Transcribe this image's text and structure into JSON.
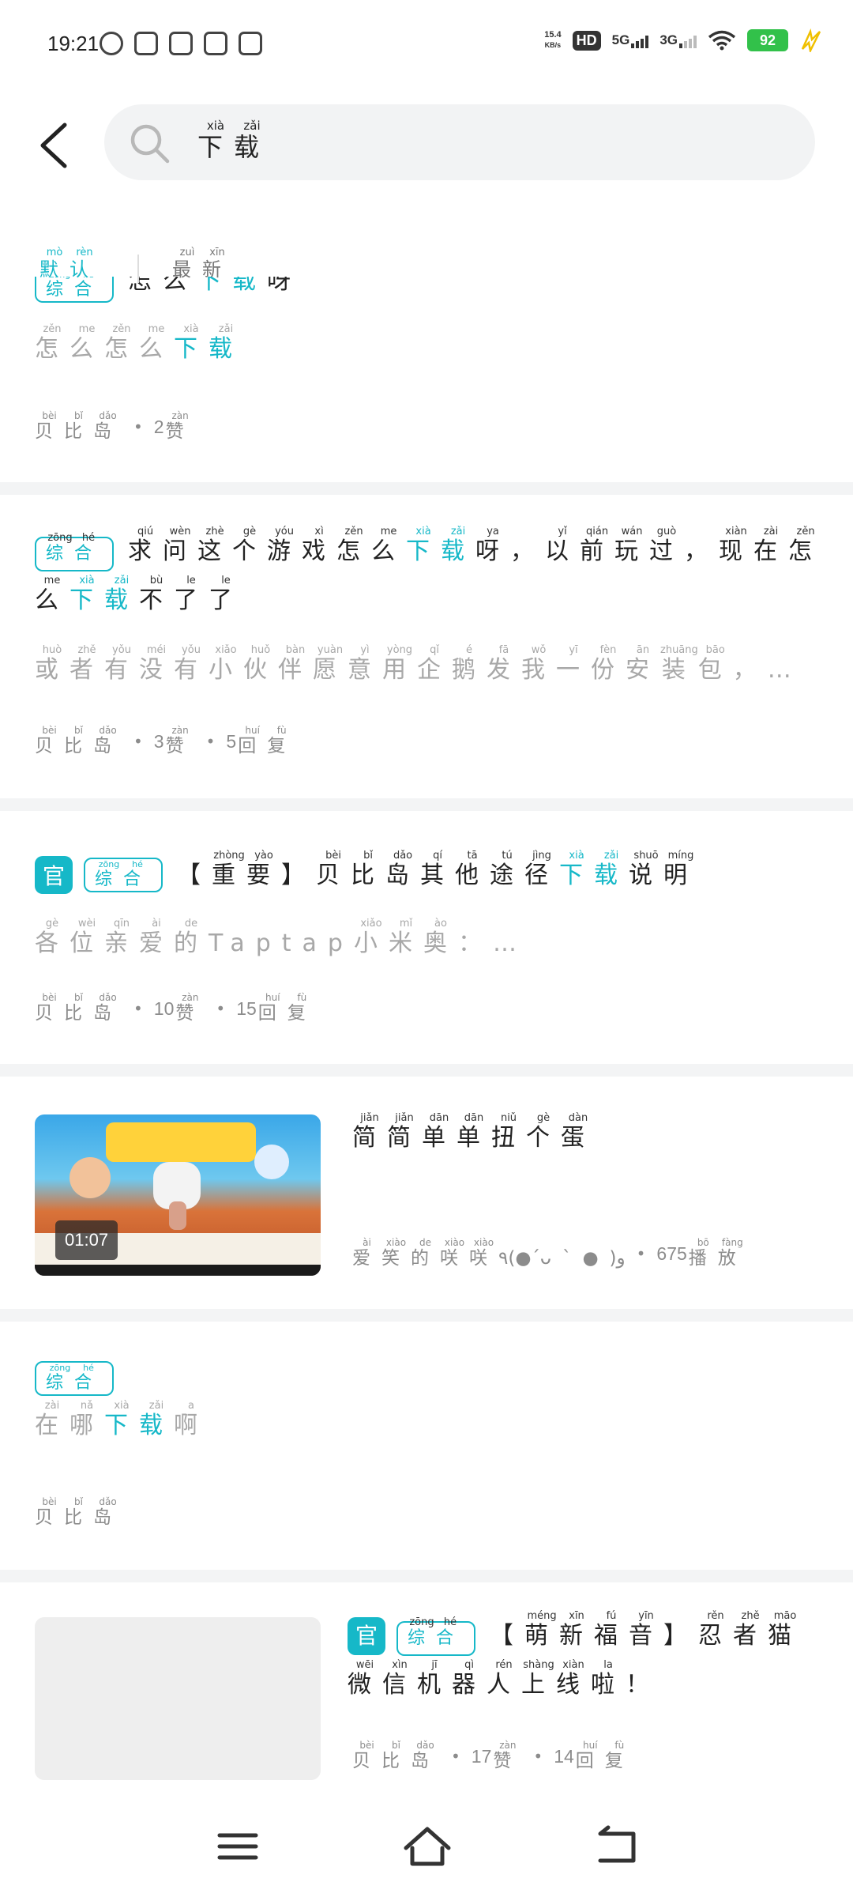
{
  "status_bar": {
    "time": "19:21",
    "net_speed": "15.4",
    "net_unit": "KB/s",
    "hd": "HD",
    "sim1": "5G",
    "sim2": "3G",
    "battery": "92",
    "app_icons": [
      "hamster-icon",
      "shopping-bag-icon",
      "team-icon",
      "qq-music-icon",
      "alipay-icon"
    ]
  },
  "header": {
    "search_value": [
      {
        "c": "下",
        "p": "xià"
      },
      {
        "c": "载",
        "p": "zǎi"
      }
    ]
  },
  "filters": [
    {
      "label": [
        {
          "c": "默",
          "p": "mò"
        },
        {
          "c": "认",
          "p": "rèn"
        }
      ],
      "active": true
    },
    {
      "label": [
        {
          "c": "最",
          "p": "zuì"
        },
        {
          "c": "新",
          "p": "xīn"
        }
      ],
      "active": false
    }
  ],
  "tags": {
    "official": "官",
    "general": [
      {
        "c": "综",
        "p": "zōng"
      },
      {
        "c": "合",
        "p": "hé"
      }
    ]
  },
  "posts": [
    {
      "title_partial": [
        {
          "c": "怎"
        },
        {
          "c": "么"
        },
        {
          "c": "下",
          "h": true
        },
        {
          "c": "载",
          "h": true
        },
        {
          "c": "呀"
        }
      ],
      "snippet": [
        {
          "c": "怎",
          "p": "zěn"
        },
        {
          "c": "么",
          "p": "me"
        },
        {
          "c": "怎",
          "p": "zěn"
        },
        {
          "c": "么",
          "p": "me"
        },
        {
          "c": "下",
          "p": "xià",
          "h": true
        },
        {
          "c": "载",
          "p": "zǎi",
          "h": true
        }
      ],
      "meta": {
        "author": [
          {
            "c": "贝",
            "p": "bèi"
          },
          {
            "c": "比",
            "p": "bǐ"
          },
          {
            "c": "岛",
            "p": "dǎo"
          }
        ],
        "likes": "2"
      }
    },
    {
      "title": [
        {
          "c": "求",
          "p": "qiú"
        },
        {
          "c": "问",
          "p": "wèn"
        },
        {
          "c": "这",
          "p": "zhè"
        },
        {
          "c": "个",
          "p": "gè"
        },
        {
          "c": "游",
          "p": "yóu"
        },
        {
          "c": "戏",
          "p": "xì"
        },
        {
          "c": "怎",
          "p": "zěn"
        },
        {
          "c": "么",
          "p": "me"
        },
        {
          "c": "下",
          "p": "xià",
          "h": true
        },
        {
          "c": "载",
          "p": "zǎi",
          "h": true
        },
        {
          "c": "呀",
          "p": "ya"
        },
        {
          "c": "，"
        },
        {
          "c": "以",
          "p": "yǐ"
        },
        {
          "c": "前",
          "p": "qián"
        },
        {
          "c": "玩",
          "p": "wán"
        },
        {
          "c": "过",
          "p": "guò"
        },
        {
          "c": "，"
        },
        {
          "c": "现",
          "p": "xiàn"
        },
        {
          "c": "在",
          "p": "zài"
        },
        {
          "c": "怎",
          "p": "zěn"
        },
        {
          "c": "么",
          "p": "me"
        },
        {
          "c": "下",
          "p": "xià",
          "h": true
        },
        {
          "c": "载",
          "p": "zǎi",
          "h": true
        },
        {
          "c": "不",
          "p": "bù"
        },
        {
          "c": "了",
          "p": "le"
        },
        {
          "c": "了",
          "p": "le"
        }
      ],
      "snippet": [
        {
          "c": "或",
          "p": "huò"
        },
        {
          "c": "者",
          "p": "zhě"
        },
        {
          "c": "有",
          "p": "yǒu"
        },
        {
          "c": "没",
          "p": "méi"
        },
        {
          "c": "有",
          "p": "yǒu"
        },
        {
          "c": "小",
          "p": "xiǎo"
        },
        {
          "c": "伙",
          "p": "huǒ"
        },
        {
          "c": "伴",
          "p": "bàn"
        },
        {
          "c": "愿",
          "p": "yuàn"
        },
        {
          "c": "意",
          "p": "yì"
        },
        {
          "c": "用",
          "p": "yòng"
        },
        {
          "c": "企",
          "p": "qǐ"
        },
        {
          "c": "鹅",
          "p": "é"
        },
        {
          "c": "发",
          "p": "fā"
        },
        {
          "c": "我",
          "p": "wǒ"
        },
        {
          "c": "一",
          "p": "yī"
        },
        {
          "c": "份",
          "p": "fèn"
        },
        {
          "c": "安",
          "p": "ān"
        },
        {
          "c": "装",
          "p": "zhuāng"
        },
        {
          "c": "包",
          "p": "bāo"
        },
        {
          "c": "，…"
        }
      ],
      "meta": {
        "author": [
          {
            "c": "贝",
            "p": "bèi"
          },
          {
            "c": "比",
            "p": "bǐ"
          },
          {
            "c": "岛",
            "p": "dǎo"
          }
        ],
        "likes": "3",
        "replies": "5"
      }
    },
    {
      "title": [
        {
          "c": "【"
        },
        {
          "c": "重",
          "p": "zhòng"
        },
        {
          "c": "要",
          "p": "yào"
        },
        {
          "c": "】"
        },
        {
          "c": "贝",
          "p": "bèi"
        },
        {
          "c": "比",
          "p": "bǐ"
        },
        {
          "c": "岛",
          "p": "dǎo"
        },
        {
          "c": "其",
          "p": "qí"
        },
        {
          "c": "他",
          "p": "tā"
        },
        {
          "c": "途",
          "p": "tú"
        },
        {
          "c": "径",
          "p": "jìng"
        },
        {
          "c": "下",
          "p": "xià",
          "h": true
        },
        {
          "c": "载",
          "p": "zǎi",
          "h": true
        },
        {
          "c": "说",
          "p": "shuō"
        },
        {
          "c": "明",
          "p": "míng"
        }
      ],
      "snippet": [
        {
          "c": "各",
          "p": "gè"
        },
        {
          "c": "位",
          "p": "wèi"
        },
        {
          "c": "亲",
          "p": "qīn"
        },
        {
          "c": "爱",
          "p": "ài"
        },
        {
          "c": "的",
          "p": "de"
        },
        {
          "c": "Taptap"
        },
        {
          "c": "小",
          "p": "xiǎo"
        },
        {
          "c": "米",
          "p": "mǐ"
        },
        {
          "c": "奥",
          "p": "ào"
        },
        {
          "c": "：…"
        }
      ],
      "meta": {
        "author": [
          {
            "c": "贝",
            "p": "bèi"
          },
          {
            "c": "比",
            "p": "bǐ"
          },
          {
            "c": "岛",
            "p": "dǎo"
          }
        ],
        "likes": "10",
        "replies": "15"
      }
    },
    {
      "title": [
        {
          "c": "简",
          "p": "jiǎn"
        },
        {
          "c": "简",
          "p": "jiǎn"
        },
        {
          "c": "单",
          "p": "dān"
        },
        {
          "c": "单",
          "p": "dān"
        },
        {
          "c": "扭",
          "p": "niǔ"
        },
        {
          "c": "个",
          "p": "gè"
        },
        {
          "c": "蛋",
          "p": "dàn"
        }
      ],
      "duration": "01:07",
      "meta": {
        "author": [
          {
            "c": "爱",
            "p": "ài"
          },
          {
            "c": "笑",
            "p": "xiào"
          },
          {
            "c": "的",
            "p": "de"
          },
          {
            "c": "咲",
            "p": "xiào"
          },
          {
            "c": "咲",
            "p": "xiào"
          },
          {
            "c": "٩(●ˊᴗˋ●)و"
          }
        ],
        "plays": "675"
      }
    },
    {
      "title": [
        {
          "c": "在",
          "p": "zài"
        },
        {
          "c": "哪",
          "p": "nǎ"
        },
        {
          "c": "下",
          "p": "xià",
          "h": true
        },
        {
          "c": "载",
          "p": "zǎi",
          "h": true
        },
        {
          "c": "啊",
          "p": "a"
        }
      ],
      "meta": {
        "author": [
          {
            "c": "贝",
            "p": "bèi"
          },
          {
            "c": "比",
            "p": "bǐ"
          },
          {
            "c": "岛",
            "p": "dǎo"
          }
        ]
      }
    },
    {
      "title": [
        {
          "c": "【"
        },
        {
          "c": "萌",
          "p": "méng"
        },
        {
          "c": "新",
          "p": "xīn"
        },
        {
          "c": "福",
          "p": "fú"
        },
        {
          "c": "音",
          "p": "yīn"
        },
        {
          "c": "】"
        },
        {
          "c": "忍",
          "p": "rěn"
        },
        {
          "c": "者",
          "p": "zhě"
        },
        {
          "c": "猫",
          "p": "māo"
        },
        {
          "c": "微",
          "p": "wēi"
        },
        {
          "c": "信",
          "p": "xìn"
        },
        {
          "c": "机",
          "p": "jī"
        },
        {
          "c": "器",
          "p": "qì"
        },
        {
          "c": "人",
          "p": "rén"
        },
        {
          "c": "上",
          "p": "shàng"
        },
        {
          "c": "线",
          "p": "xiàn"
        },
        {
          "c": "啦",
          "p": "la"
        },
        {
          "c": "！"
        }
      ],
      "meta": {
        "author": [
          {
            "c": "贝",
            "p": "bèi"
          },
          {
            "c": "比",
            "p": "bǐ"
          },
          {
            "c": "岛",
            "p": "dǎo"
          }
        ],
        "likes": "17",
        "replies": "14"
      }
    }
  ],
  "meta_words": {
    "likes": [
      {
        "c": "赞",
        "p": "zàn"
      }
    ],
    "replies": [
      {
        "c": "回",
        "p": "huí"
      },
      {
        "c": "复",
        "p": "fù"
      }
    ],
    "plays": [
      {
        "c": "播",
        "p": "bō"
      },
      {
        "c": "放",
        "p": "fàng"
      }
    ],
    "dot": "•"
  },
  "nav": [
    "menu-icon",
    "home-icon",
    "back-icon"
  ],
  "colors": {
    "accent": "#16b8c8",
    "battery": "#32c14a",
    "divider": "#f3f4f5"
  }
}
